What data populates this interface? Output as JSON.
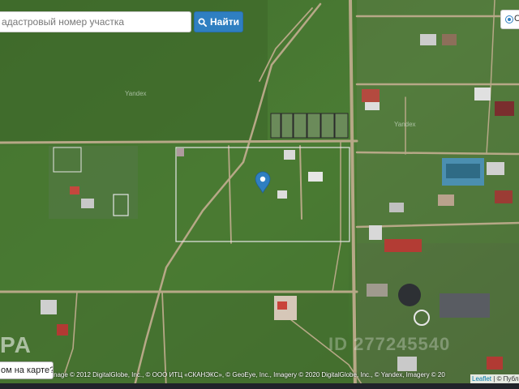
{
  "search": {
    "placeholder": "адастровый номер участка",
    "button_label": "Найти",
    "button_icon": "search-icon"
  },
  "layer_switch": {
    "label": "С"
  },
  "map_labels": {
    "yandex_1": "Yandex",
    "yandex_2": "Yandex"
  },
  "watermarks": {
    "brand": "PA",
    "listing_id": "ID 277245540"
  },
  "feedback": {
    "label": "ом на карте?"
  },
  "attribution": {
    "text": "nage © 2012 DigitalGlobe, Inc., © ООО ИТЦ «СКАНЭКС», © GeoEye, Inc., Imagery © 2020 DigitalGlobe, Inc., © Yandex, Imagery © 20",
    "leaflet_link": "Leaflet",
    "suffix": "| © Публ"
  },
  "colors": {
    "accent": "#2f7fc1",
    "marker": "#2f7fc1",
    "field_dark": "#3b6528",
    "field": "#4a7a33",
    "road": "#b7a887",
    "plot_outline": "#e6e6e6"
  },
  "icons": {
    "marker": "map-marker-icon"
  }
}
